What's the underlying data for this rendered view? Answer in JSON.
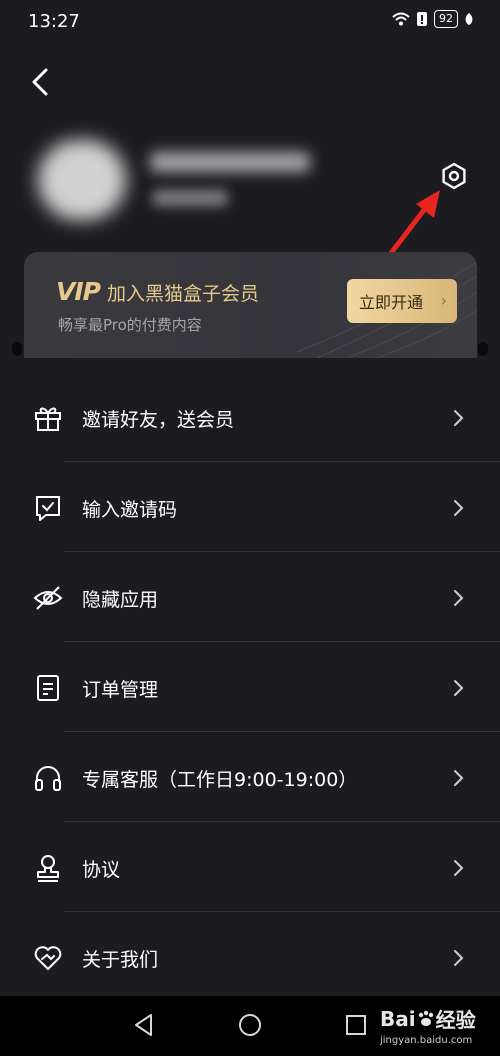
{
  "status_bar": {
    "time": "13:27",
    "battery": "92"
  },
  "vip": {
    "logo": "VIP",
    "title": "加入黑猫盒子会员",
    "subtitle": "畅享最Pro的付费内容",
    "button_label": "立即开通"
  },
  "menu": [
    {
      "label": "邀请好友，送会员",
      "icon": "gift-icon"
    },
    {
      "label": "输入邀请码",
      "icon": "message-check-icon"
    },
    {
      "label": "隐藏应用",
      "icon": "eye-off-icon"
    },
    {
      "label": "订单管理",
      "icon": "document-icon"
    },
    {
      "label": "专属客服（工作日9:00-19:00）",
      "icon": "headphones-icon"
    },
    {
      "label": "协议",
      "icon": "stamp-icon"
    },
    {
      "label": "关于我们",
      "icon": "heart-handshake-icon"
    }
  ],
  "watermark": {
    "logo": "Bai",
    "suffix": "经验",
    "url": "jingyan.baidu.com"
  },
  "colors": {
    "background": "#1c1b20",
    "gold": "#e5c98d",
    "arrow": "#e8241f"
  }
}
